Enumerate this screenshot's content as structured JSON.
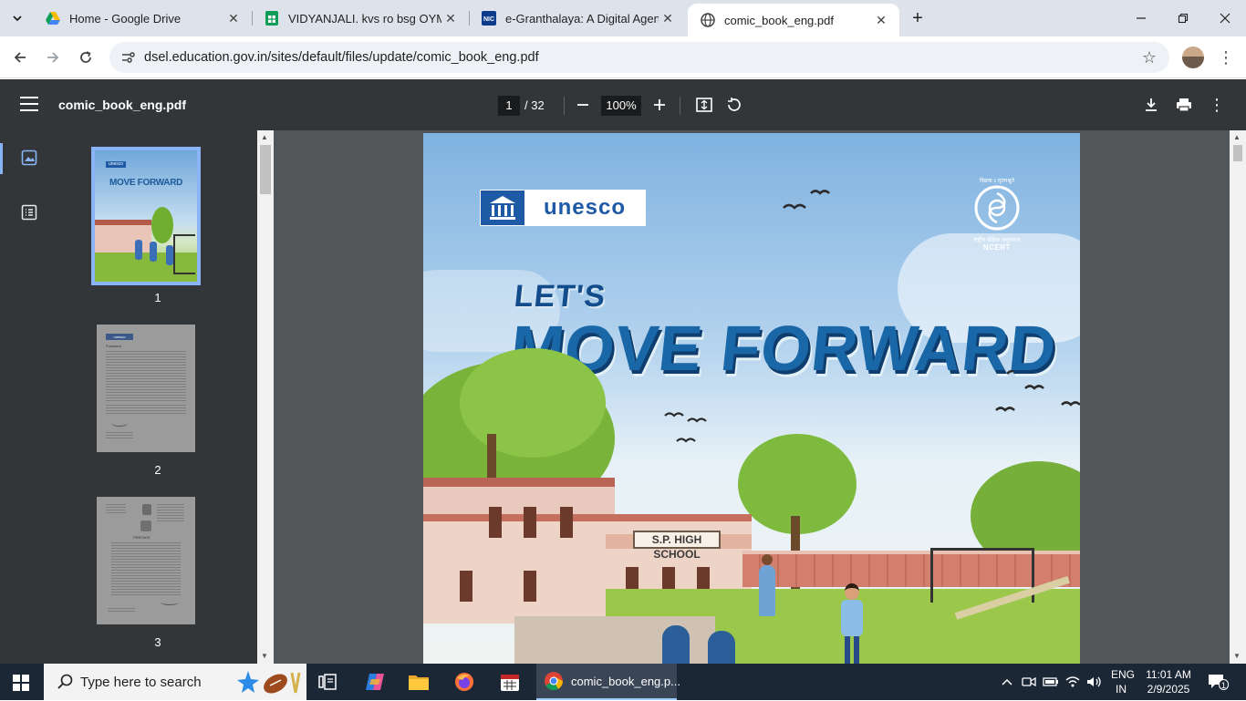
{
  "browser": {
    "tabs": [
      {
        "title": "Home - Google Drive",
        "icon": "google-drive-icon"
      },
      {
        "title": "VIDYANJALI. kvs ro bsg OYMS a",
        "icon": "google-sheets-icon"
      },
      {
        "title": "e-Granthalaya: A Digital Agenda",
        "icon": "nic-icon"
      },
      {
        "title": "comic_book_eng.pdf",
        "icon": "globe-icon",
        "active": true
      }
    ],
    "url": "dsel.education.gov.in/sites/default/files/update/comic_book_eng.pdf"
  },
  "pdf": {
    "filename": "comic_book_eng.pdf",
    "current_page": "1",
    "total_pages": "/ 32",
    "zoom": "100%",
    "thumbnails": [
      {
        "label": "1",
        "selected": true
      },
      {
        "label": "2"
      },
      {
        "label": "3"
      }
    ],
    "cover": {
      "brand": "unesco",
      "logo_tagline": "विद्यया ऽ मृतमश्नुते",
      "logo_name": "राष्ट्रीय शैक्षिक अनुसंधान",
      "logo_abbr": "NCERT",
      "title_small": "LET'S",
      "title_big": "MOVE FORWARD",
      "school_sign": "S.P. HIGH SCHOOL"
    },
    "thumb_text": {
      "t1_brand": "unesco",
      "t1_title": "MOVE FORWARD",
      "t2_heading": "Foreword",
      "t3_heading": "PREFACE"
    }
  },
  "taskbar": {
    "search_placeholder": "Type here to search",
    "active_app": "comic_book_eng.p...",
    "lang_top": "ENG",
    "lang_bottom": "IN",
    "time": "11:01 AM",
    "date": "2/9/2025",
    "notification_count": "1"
  },
  "colors": {
    "pdf_toolbar": "#323639",
    "pdf_background": "#525659",
    "taskbar": "#1c2736",
    "unesco_blue": "#1f5aa6"
  }
}
